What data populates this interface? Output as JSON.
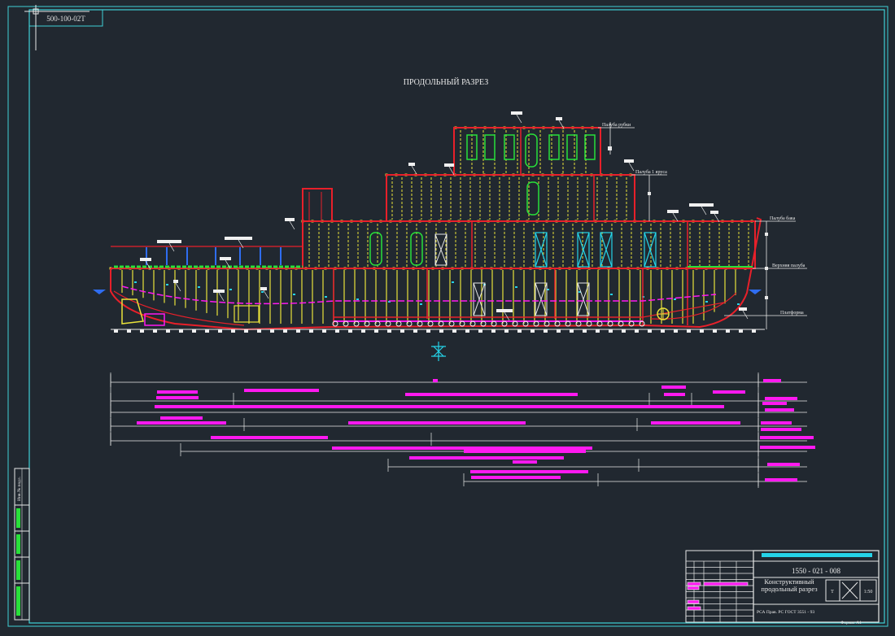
{
  "corner_tag": "500-100-02Т",
  "title": "ПРОДОЛЬНЫЙ   РАЗРЕЗ",
  "deck_labels": {
    "wheelhouse": "Палуба рубки",
    "deck_1": "Палуба 1 яруса",
    "boat": "Палуба бака",
    "upper": "Верхняя палуба",
    "platform": "Платформа"
  },
  "title_block": {
    "drawing_number": "1550 - 021 - 008",
    "drawing_title": "Конструктивный продольный разрез",
    "scale": "1:50",
    "sheet": "Т",
    "register": "РСА Прав. РС ГОСТ 3551 - 93",
    "format": "Формат А1"
  },
  "side_stamp": "Инв.№ подл.",
  "colors": {
    "background": "#212830",
    "frame": "#3fd0d6",
    "hull": "#e8202a",
    "frames_yellow": "#e9e23a",
    "magenta": "#ff19f0",
    "green": "#29e03a",
    "cyan": "#25d3e8",
    "white": "#f0f0f0"
  }
}
